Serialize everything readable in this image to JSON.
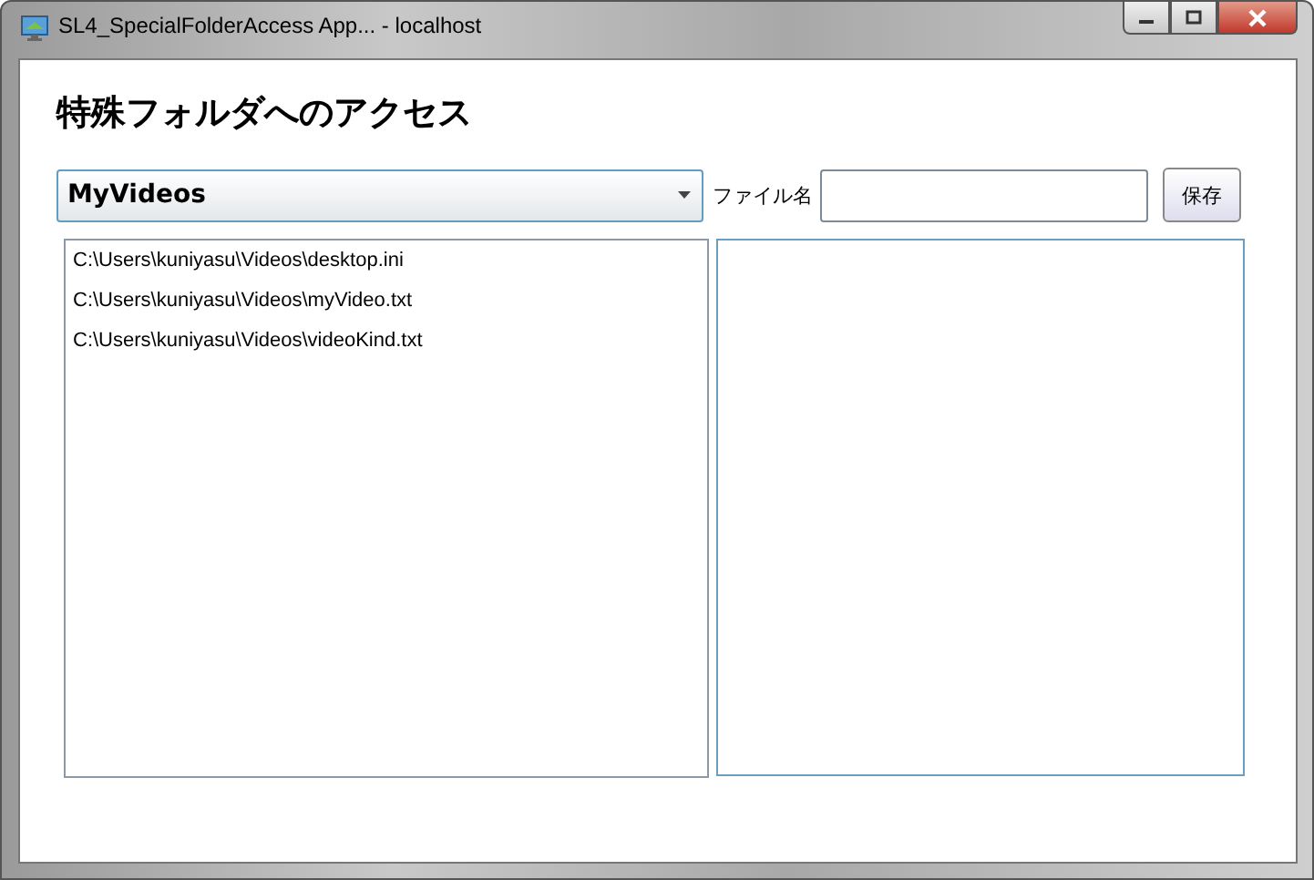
{
  "window": {
    "title": "SL4_SpecialFolderAccess App... - localhost"
  },
  "heading": "特殊フォルダへのアクセス",
  "folder_select": {
    "value": "MyVideos"
  },
  "file_name": {
    "label": "ファイル名"
  },
  "save_button": "保存",
  "files": [
    {
      "path": "C:\\Users\\kuniyasu\\Videos\\desktop.ini"
    },
    {
      "path": "C:\\Users\\kuniyasu\\Videos\\myVideo.txt"
    },
    {
      "path": "C:\\Users\\kuniyasu\\Videos\\videoKind.txt"
    }
  ]
}
